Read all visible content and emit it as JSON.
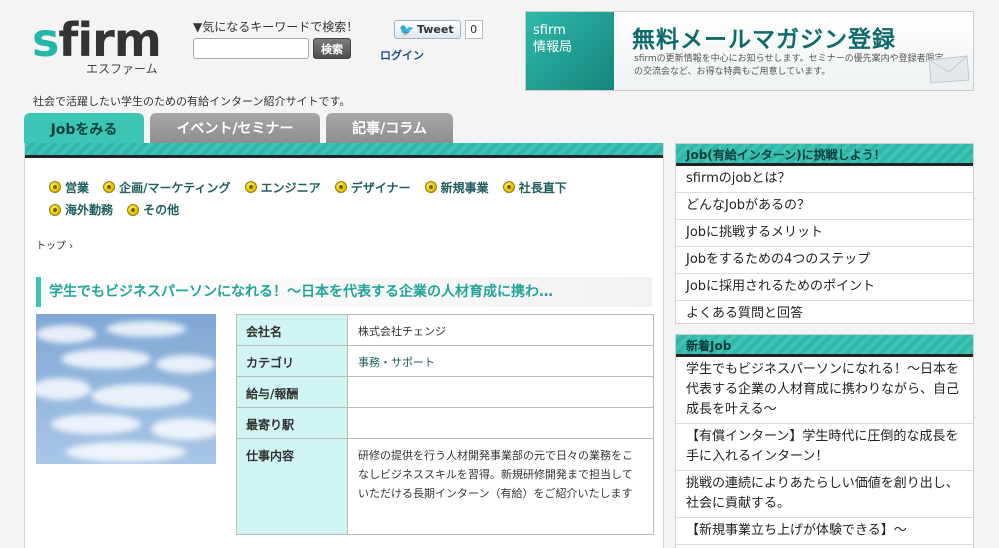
{
  "logo": {
    "word_s": "s",
    "word_rest": "firm",
    "kana": "エスファーム"
  },
  "search": {
    "label": "▼気になるキーワードで検索！",
    "value": "",
    "placeholder": "",
    "button": "検索"
  },
  "tweet": {
    "label": "Tweet",
    "count": "0"
  },
  "login": "ログイン",
  "banner": {
    "left_line1": "sfirm",
    "left_line2": "情報局",
    "title": "無料メールマガジン登録",
    "desc": "sfirmの更新情報を中心にお知らせします。セミナーの優先案内や登録者限定の交流会など、お得な特典もご用意しています。"
  },
  "tagline": "社会で活躍したい学生のための有給インターン紹介サイトです。",
  "tabs": [
    {
      "label": "Jobをみる",
      "active": true
    },
    {
      "label": "イベント/セミナー",
      "active": false
    },
    {
      "label": "記事/コラム",
      "active": false
    }
  ],
  "categories": [
    "営業",
    "企画/マーケティング",
    "エンジニア",
    "デザイナー",
    "新規事業",
    "社長直下",
    "海外勤務",
    "その他"
  ],
  "breadcrumb": "トップ ›",
  "job": {
    "title": "学生でもビジネスパーソンになれる！〜日本を代表する企業の人材育成に携わ…",
    "rows": [
      {
        "label": "会社名",
        "value": "株式会社チェンジ"
      },
      {
        "label": "カテゴリ",
        "value": "事務・サポート"
      },
      {
        "label": "給与/報酬",
        "value": ""
      },
      {
        "label": "最寄り駅",
        "value": ""
      },
      {
        "label": "仕事内容",
        "value": "研修の提供を行う人材開発事業部の元で日々の業務をこなしビジネススキルを習得。新規研修開発まで担当していただける長期インターン（有給）をご紹介いたします"
      }
    ]
  },
  "sidebar": {
    "job_box": {
      "title": "Job(有給インターン)に挑戦しよう！",
      "items": [
        "sfirmのjobとは？",
        "どんなJobがあるの？",
        "Jobに挑戦するメリット",
        "Jobをするための4つのステップ",
        "Jobに採用されるためのポイント",
        "よくある質問と回答"
      ]
    },
    "new_box": {
      "title": "新着Job",
      "items": [
        "学生でもビジネスパーソンになれる！〜日本を代表する企業の人材育成に携わりながら、自己成長を叶える〜",
        "【有償インターン】学生時代に圧倒的な成長を手に入れるインターン！",
        "挑戦の連続によりあたらしい価値を創り出し、社会に貢献する。",
        "【新規事業立ち上げが体験できる】〜"
      ]
    }
  },
  "colors": {
    "accent": "#3cc4b5",
    "accent_dark": "#22a597",
    "tab_inactive": "#999999"
  },
  "icons": {
    "category_bullet": "yellow-circle-icon",
    "tweet": "twitter-bird-icon",
    "banner": "envelope-icon"
  }
}
